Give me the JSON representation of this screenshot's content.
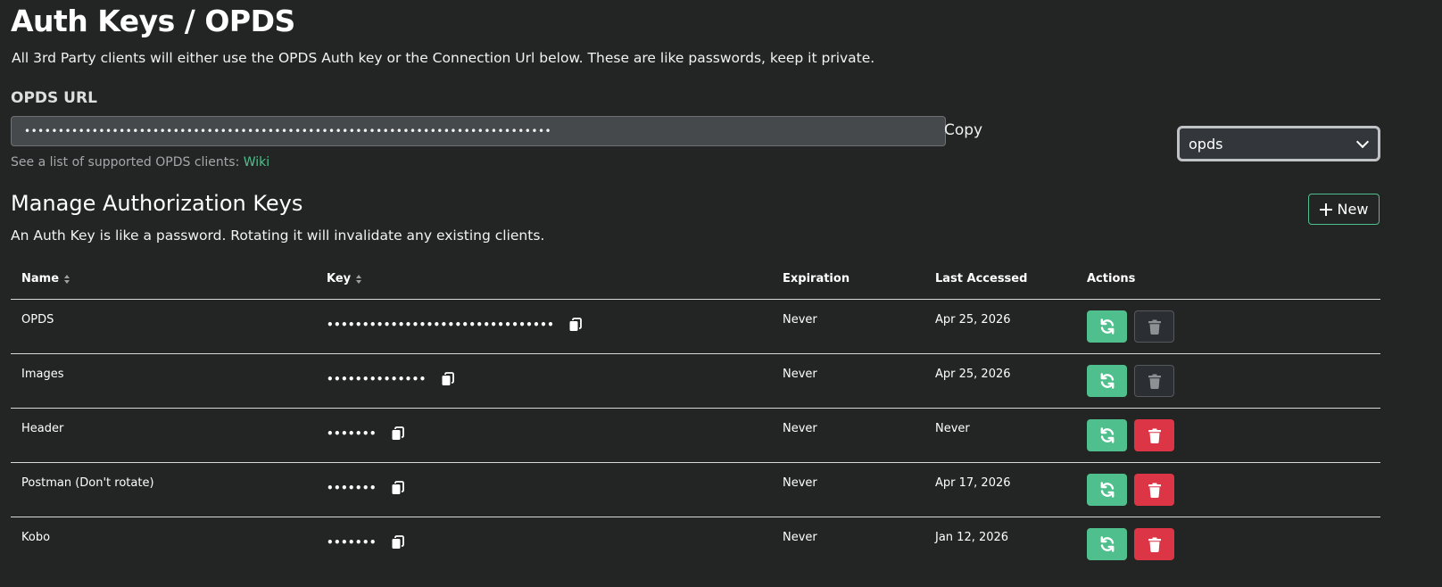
{
  "header": {
    "title": "Auth Keys / OPDS",
    "subtitle": "All 3rd Party clients will either use the OPDS Auth key or the Connection Url below. These are like passwords, keep it private."
  },
  "opds": {
    "label": "OPDS URL",
    "url_value": "••••••••••••••••••••••••••••••••••••••••••••••••••••••••••••••••••••••••••••••",
    "copy_label": "Copy",
    "hint_text": "See a list of supported OPDS clients: ",
    "wiki_label": "Wiki",
    "key_select_value": "opds"
  },
  "manage": {
    "title": "Manage Authorization Keys",
    "subtitle": "An Auth Key is like a password. Rotating it will invalidate any existing clients.",
    "new_button_label": "New"
  },
  "table": {
    "columns": {
      "name": "Name",
      "key": "Key",
      "expiration": "Expiration",
      "last_accessed": "Last Accessed",
      "actions": "Actions"
    },
    "rows": [
      {
        "name": "OPDS",
        "key": "••••••••••••••••••••••••••••••••",
        "expiration": "Never",
        "last_accessed": "Apr 25, 2026",
        "delete_enabled": false
      },
      {
        "name": "Images",
        "key": "••••••••••••••",
        "expiration": "Never",
        "last_accessed": "Apr 25, 2026",
        "delete_enabled": false
      },
      {
        "name": "Header",
        "key": "•••••••",
        "expiration": "Never",
        "last_accessed": "Never",
        "delete_enabled": true
      },
      {
        "name": "Postman (Don't rotate)",
        "key": "•••••••",
        "expiration": "Never",
        "last_accessed": "Apr 17, 2026",
        "delete_enabled": true
      },
      {
        "name": "Kobo",
        "key": "•••••••",
        "expiration": "Never",
        "last_accessed": "Jan 12, 2026",
        "delete_enabled": true
      }
    ]
  },
  "colors": {
    "background": "#232424",
    "accent_green": "#4fc08d",
    "danger_red": "#dc3545",
    "input_bg": "#45494b"
  },
  "icons": {
    "copy": "copy-icon",
    "rotate": "rotate-icon",
    "delete": "trash-icon",
    "add": "plus-icon",
    "dropdown": "chevron-down-icon",
    "sort": "sort-icon"
  }
}
